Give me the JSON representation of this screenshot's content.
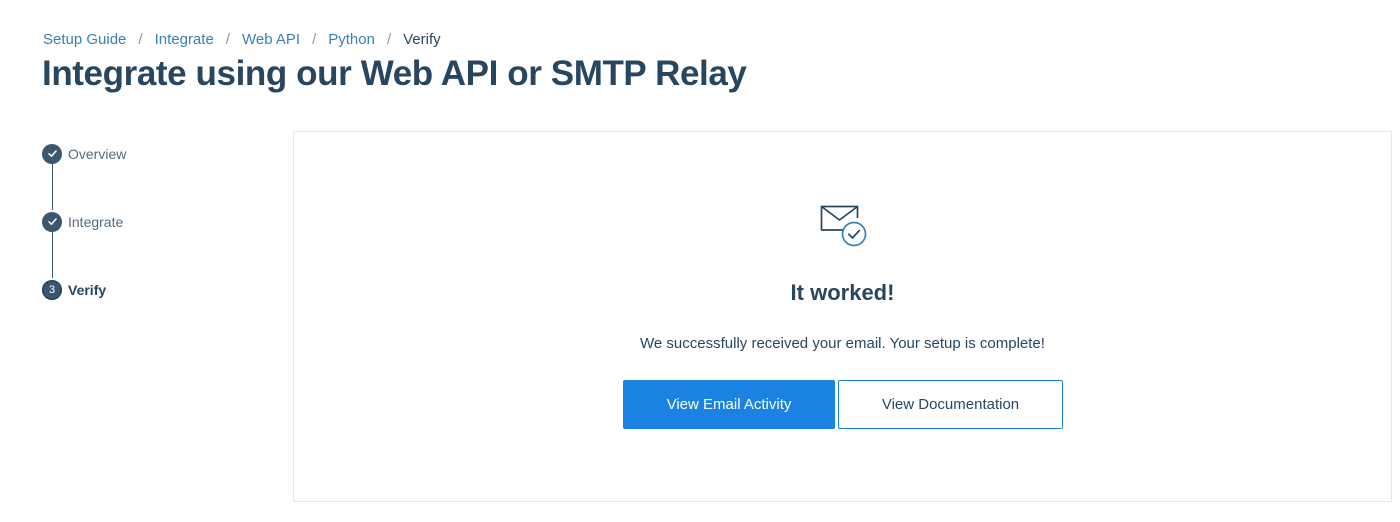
{
  "breadcrumb": {
    "items": [
      "Setup Guide",
      "Integrate",
      "Web API",
      "Python"
    ],
    "separator": "/",
    "current": "Verify"
  },
  "page": {
    "title": "Integrate using our Web API or SMTP Relay"
  },
  "stepper": {
    "steps": [
      {
        "label": "Overview",
        "state": "completed",
        "icon": "check-icon"
      },
      {
        "label": "Integrate",
        "state": "completed",
        "icon": "check-icon"
      },
      {
        "label": "Verify",
        "state": "current",
        "number": "3"
      }
    ]
  },
  "card": {
    "icon": "mail-check-icon",
    "title": "It worked!",
    "message": "We successfully received your email. Your setup is complete!",
    "primary_button": "View Email Activity",
    "secondary_button": "View Documentation"
  },
  "colors": {
    "primary": "#1a82e2",
    "text": "#294661",
    "link": "#3b7fb8",
    "border": "#e4e9ee"
  }
}
